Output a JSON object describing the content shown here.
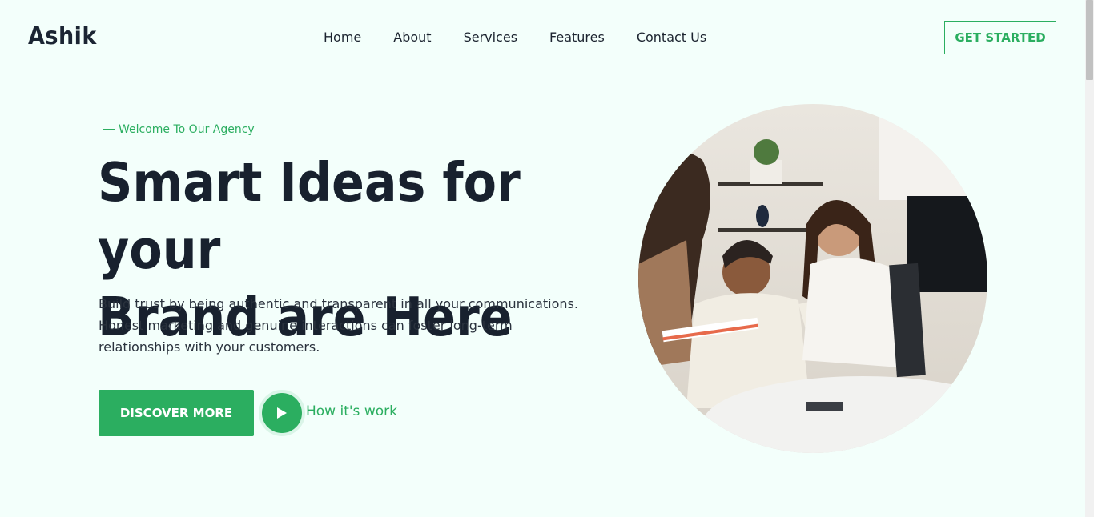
{
  "header": {
    "logo": "Ashik",
    "nav": [
      "Home",
      "About",
      "Services",
      "Features",
      "Contact Us"
    ],
    "cta": "GET STARTED"
  },
  "hero": {
    "tagline": "Welcome To Our Agency",
    "title_line1": "Smart Ideas for your",
    "title_line2": "Brand are Here",
    "description": "Build trust by being authentic and transparent in all your communications. Honest marketing and genuine interactions can foster long-term relationships with your customers.",
    "primary_button": "DISCOVER MORE",
    "video_link": "How it's work"
  },
  "icons": {
    "play": "play-icon",
    "image": "team-photo"
  },
  "colors": {
    "accent": "#2bae60",
    "background": "#f3fffb",
    "heading": "#18212e"
  }
}
